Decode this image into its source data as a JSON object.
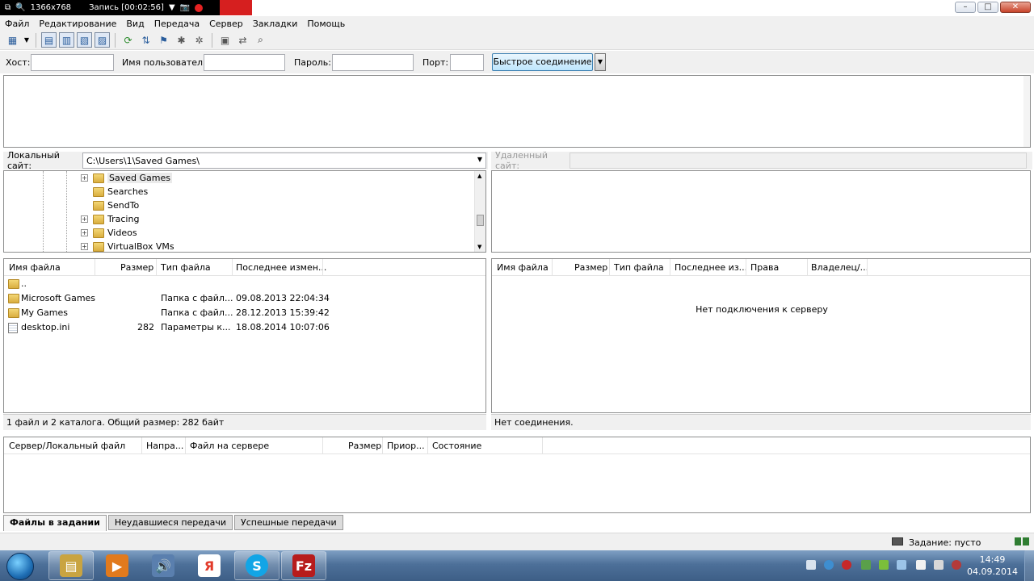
{
  "recorder": {
    "resolution": "1366x768",
    "status": "Запись [00:02:56]"
  },
  "menu": [
    "Файл",
    "Редактирование",
    "Вид",
    "Передача",
    "Сервер",
    "Закладки",
    "Помощь"
  ],
  "quickconnect": {
    "host_label": "Хост:",
    "user_label": "Имя пользователя",
    "pass_label": "Пароль:",
    "port_label": "Порт:",
    "button_label": "Быстрое соединение"
  },
  "local": {
    "label": "Локальный сайт:",
    "path": "C:\\Users\\1\\Saved Games\\",
    "tree": [
      {
        "name": "Saved Games",
        "expander": "+"
      },
      {
        "name": "Searches",
        "expander": ""
      },
      {
        "name": "SendTo",
        "expander": ""
      },
      {
        "name": "Tracing",
        "expander": "+"
      },
      {
        "name": "Videos",
        "expander": "+"
      },
      {
        "name": "VirtualBox VMs",
        "expander": "+"
      }
    ],
    "columns": [
      "Имя файла",
      "Размер",
      "Тип файла",
      "Последнее измен..."
    ],
    "files": [
      {
        "name": "..",
        "size": "",
        "type": "",
        "modified": "",
        "icon": "folder-icon"
      },
      {
        "name": "Microsoft Games",
        "size": "",
        "type": "Папка с файл...",
        "modified": "09.08.2013 22:04:34",
        "icon": "folder-icon"
      },
      {
        "name": "My Games",
        "size": "",
        "type": "Папка с файл...",
        "modified": "28.12.2013 15:39:42",
        "icon": "folder-icon"
      },
      {
        "name": "desktop.ini",
        "size": "282",
        "type": "Параметры к...",
        "modified": "18.08.2014 10:07:06",
        "icon": "file-icon"
      }
    ],
    "status": "1 файл и 2 каталога. Общий размер: 282 байт"
  },
  "remote": {
    "label": "Удаленный сайт:",
    "columns": [
      "Имя файла",
      "Размер",
      "Тип файла",
      "Последнее из...",
      "Права",
      "Владелец/..."
    ],
    "empty_message": "Нет подключения к серверу",
    "status": "Нет соединения."
  },
  "queue": {
    "columns": [
      "Сервер/Локальный файл",
      "Напра...",
      "Файл на сервере",
      "Размер",
      "Приор...",
      "Состояние"
    ],
    "tabs": [
      "Файлы в задании",
      "Неудавшиеся передачи",
      "Успешные передачи"
    ],
    "status": "Задание: пусто"
  },
  "taskbar": {
    "time": "14:49",
    "date": "04.09.2014",
    "apps": [
      {
        "name": "explorer",
        "glyph": "▤",
        "color": "#c9a441"
      },
      {
        "name": "media-player",
        "glyph": "▶",
        "color": "#e17a1d"
      },
      {
        "name": "volume",
        "glyph": "🔊",
        "color": "#5a7fae"
      },
      {
        "name": "yandex",
        "glyph": "Я",
        "color": "#e23a2a"
      },
      {
        "name": "skype",
        "glyph": "S",
        "color": "#12a5e6"
      },
      {
        "name": "filezilla",
        "glyph": "Fz",
        "color": "#b71c1c"
      }
    ]
  }
}
